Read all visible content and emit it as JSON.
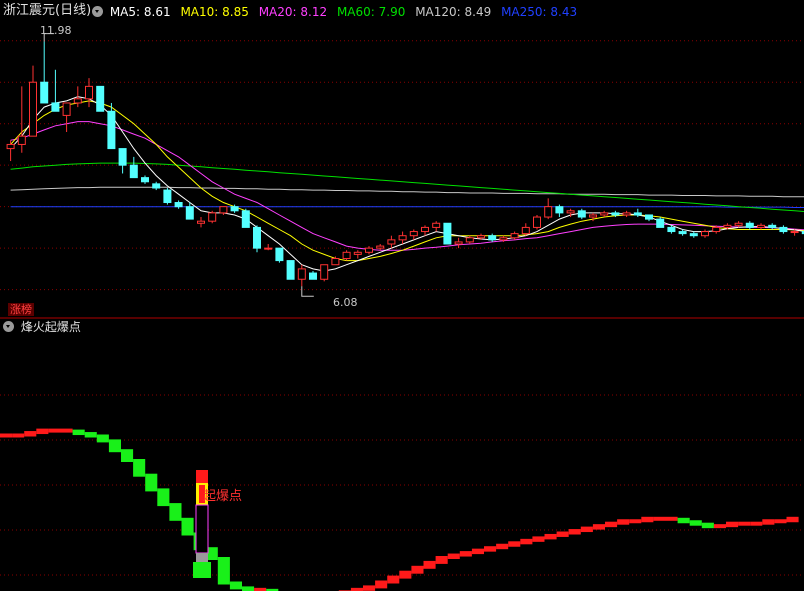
{
  "header": {
    "stock_title": "浙江震元(日线)",
    "ma_items": [
      {
        "label": "MA5: 8.61",
        "color": "#ffffff"
      },
      {
        "label": "MA10: 8.85",
        "color": "#ffff00"
      },
      {
        "label": "MA20: 8.12",
        "color": "#ff40ff"
      },
      {
        "label": "MA60: 7.90",
        "color": "#00e000"
      },
      {
        "label": "MA120: 8.49",
        "color": "#c8c8c8"
      },
      {
        "label": "MA250: 8.43",
        "color": "#2040ff"
      }
    ]
  },
  "main_panel": {
    "tag": "涨榜",
    "max_label": "11.98",
    "min_label": "6.08"
  },
  "indicator": {
    "title": "烽火起爆点",
    "signal_label": "起爆点"
  },
  "colors": {
    "up": "#ff3232",
    "down": "#54ffff",
    "grid": "#8a0000",
    "ma5": "#ffffff",
    "ma10": "#ffff00",
    "ma20": "#ff40ff",
    "ma60": "#00e000",
    "ma120": "#c8c8c8",
    "ma250": "#2040ff",
    "ind_up": "#ff1a1a",
    "ind_down": "#19f019"
  },
  "chart_data": [
    {
      "type": "candlestick",
      "ylim": [
        5.75,
        12.5
      ],
      "ohlc": [
        [
          9.4,
          9.6,
          9.1,
          9.5
        ],
        [
          9.5,
          10.9,
          9.3,
          9.7
        ],
        [
          9.7,
          11.4,
          9.7,
          11.0
        ],
        [
          11.0,
          11.98,
          10.8,
          10.5
        ],
        [
          10.5,
          11.3,
          10.3,
          10.3
        ],
        [
          10.2,
          10.5,
          9.8,
          10.5
        ],
        [
          10.5,
          10.9,
          10.4,
          10.6
        ],
        [
          10.6,
          11.1,
          10.4,
          10.9
        ],
        [
          10.9,
          10.9,
          10.3,
          10.3
        ],
        [
          10.3,
          10.5,
          9.4,
          9.4
        ],
        [
          9.4,
          9.4,
          8.8,
          9.0
        ],
        [
          9.0,
          9.2,
          8.7,
          8.7
        ],
        [
          8.7,
          8.75,
          8.55,
          8.6
        ],
        [
          8.55,
          8.6,
          8.4,
          8.45
        ],
        [
          8.4,
          8.45,
          8.05,
          8.1
        ],
        [
          8.1,
          8.15,
          7.95,
          8.0
        ],
        [
          8.0,
          8.1,
          7.7,
          7.7
        ],
        [
          7.6,
          7.75,
          7.5,
          7.65
        ],
        [
          7.65,
          7.9,
          7.6,
          7.85
        ],
        [
          7.85,
          8.0,
          7.8,
          8.0
        ],
        [
          8.0,
          8.05,
          7.85,
          7.9
        ],
        [
          7.9,
          7.95,
          7.5,
          7.5
        ],
        [
          7.5,
          7.55,
          6.9,
          7.0
        ],
        [
          7.0,
          7.1,
          6.95,
          7.0
        ],
        [
          7.0,
          7.0,
          6.65,
          6.7
        ],
        [
          6.7,
          6.7,
          6.3,
          6.25
        ],
        [
          6.25,
          6.6,
          6.08,
          6.5
        ],
        [
          6.4,
          6.45,
          6.25,
          6.25
        ],
        [
          6.25,
          6.6,
          6.2,
          6.6
        ],
        [
          6.6,
          6.8,
          6.6,
          6.75
        ],
        [
          6.75,
          6.95,
          6.7,
          6.9
        ],
        [
          6.85,
          6.95,
          6.75,
          6.9
        ],
        [
          6.9,
          7.05,
          6.85,
          7.0
        ],
        [
          7.0,
          7.1,
          6.95,
          7.05
        ],
        [
          7.1,
          7.3,
          7.0,
          7.2
        ],
        [
          7.2,
          7.4,
          7.1,
          7.3
        ],
        [
          7.3,
          7.45,
          7.2,
          7.4
        ],
        [
          7.4,
          7.55,
          7.3,
          7.5
        ],
        [
          7.5,
          7.65,
          7.4,
          7.6
        ],
        [
          7.6,
          7.6,
          7.1,
          7.1
        ],
        [
          7.1,
          7.25,
          7.0,
          7.15
        ],
        [
          7.15,
          7.3,
          7.1,
          7.25
        ],
        [
          7.25,
          7.35,
          7.2,
          7.3
        ],
        [
          7.3,
          7.35,
          7.15,
          7.2
        ],
        [
          7.2,
          7.3,
          7.15,
          7.25
        ],
        [
          7.25,
          7.4,
          7.2,
          7.35
        ],
        [
          7.35,
          7.6,
          7.3,
          7.5
        ],
        [
          7.5,
          7.8,
          7.45,
          7.75
        ],
        [
          7.75,
          8.2,
          7.7,
          8.0
        ],
        [
          8.0,
          8.05,
          7.75,
          7.85
        ],
        [
          7.85,
          7.95,
          7.75,
          7.9
        ],
        [
          7.9,
          7.95,
          7.7,
          7.75
        ],
        [
          7.75,
          7.85,
          7.65,
          7.8
        ],
        [
          7.8,
          7.9,
          7.75,
          7.85
        ],
        [
          7.85,
          7.9,
          7.75,
          7.8
        ],
        [
          7.8,
          7.9,
          7.75,
          7.85
        ],
        [
          7.85,
          7.95,
          7.75,
          7.8
        ],
        [
          7.8,
          7.8,
          7.65,
          7.7
        ],
        [
          7.7,
          7.75,
          7.5,
          7.5
        ],
        [
          7.5,
          7.55,
          7.35,
          7.4
        ],
        [
          7.4,
          7.45,
          7.3,
          7.35
        ],
        [
          7.35,
          7.4,
          7.25,
          7.3
        ],
        [
          7.3,
          7.45,
          7.25,
          7.4
        ],
        [
          7.4,
          7.55,
          7.35,
          7.5
        ],
        [
          7.5,
          7.6,
          7.45,
          7.55
        ],
        [
          7.55,
          7.65,
          7.5,
          7.6
        ],
        [
          7.6,
          7.65,
          7.45,
          7.5
        ],
        [
          7.5,
          7.6,
          7.45,
          7.55
        ],
        [
          7.55,
          7.6,
          7.45,
          7.5
        ],
        [
          7.5,
          7.55,
          7.35,
          7.4
        ],
        [
          7.4,
          7.45,
          7.3,
          7.4
        ],
        [
          7.4,
          7.45,
          7.3,
          7.35
        ],
        [
          7.35,
          7.35,
          6.85,
          6.95
        ]
      ],
      "ma5": [
        9.4,
        9.7,
        10.1,
        10.4,
        10.5,
        10.55,
        10.65,
        10.6,
        10.45,
        10.2,
        9.8,
        9.4,
        9.05,
        8.75,
        8.5,
        8.3,
        8.1,
        7.9,
        7.85,
        7.85,
        7.8,
        7.7,
        7.5,
        7.3,
        7.1,
        6.85,
        6.6,
        6.5,
        6.45,
        6.5,
        6.6,
        6.7,
        6.8,
        6.9,
        7.0,
        7.1,
        7.2,
        7.3,
        7.4,
        7.35,
        7.3,
        7.25,
        7.22,
        7.2,
        7.22,
        7.25,
        7.3,
        7.4,
        7.55,
        7.7,
        7.8,
        7.85,
        7.85,
        7.85,
        7.83,
        7.83,
        7.8,
        7.75,
        7.65,
        7.55,
        7.45,
        7.4,
        7.4,
        7.42,
        7.47,
        7.5,
        7.52,
        7.52,
        7.5,
        7.47,
        7.44,
        7.4,
        7.3
      ],
      "ma10": [
        9.5,
        9.8,
        10.0,
        10.2,
        10.35,
        10.45,
        10.5,
        10.55,
        10.5,
        10.4,
        10.2,
        10.0,
        9.75,
        9.5,
        9.2,
        8.95,
        8.7,
        8.45,
        8.25,
        8.1,
        8.0,
        7.9,
        7.75,
        7.6,
        7.45,
        7.3,
        7.1,
        6.95,
        6.85,
        6.75,
        6.7,
        6.7,
        6.75,
        6.8,
        6.87,
        6.95,
        7.05,
        7.15,
        7.25,
        7.3,
        7.3,
        7.3,
        7.3,
        7.3,
        7.3,
        7.3,
        7.32,
        7.35,
        7.4,
        7.5,
        7.58,
        7.65,
        7.7,
        7.75,
        7.78,
        7.8,
        7.8,
        7.78,
        7.75,
        7.7,
        7.65,
        7.6,
        7.55,
        7.5,
        7.47,
        7.45,
        7.45,
        7.45,
        7.45,
        7.45,
        7.44,
        7.42,
        7.38
      ],
      "ma20": [
        9.6,
        9.65,
        9.75,
        9.85,
        9.95,
        10.0,
        10.05,
        10.05,
        10.0,
        9.95,
        9.85,
        9.75,
        9.65,
        9.5,
        9.35,
        9.2,
        9.0,
        8.8,
        8.6,
        8.45,
        8.3,
        8.2,
        8.1,
        7.95,
        7.8,
        7.65,
        7.5,
        7.35,
        7.25,
        7.15,
        7.05,
        7.0,
        6.97,
        6.95,
        6.95,
        6.95,
        6.97,
        7.0,
        7.02,
        7.05,
        7.08,
        7.1,
        7.12,
        7.15,
        7.18,
        7.2,
        7.23,
        7.25,
        7.3,
        7.35,
        7.4,
        7.45,
        7.5,
        7.53,
        7.55,
        7.57,
        7.58,
        7.58,
        7.58,
        7.57,
        7.56,
        7.55,
        7.54,
        7.53,
        7.52,
        7.51,
        7.5,
        7.5,
        7.49,
        7.48,
        7.46,
        7.44,
        7.4
      ],
      "ma60": [
        8.9,
        8.93,
        8.96,
        8.98,
        9.0,
        9.02,
        9.03,
        9.04,
        9.05,
        9.05,
        9.05,
        9.05,
        9.04,
        9.03,
        9.02,
        9.0,
        8.98,
        8.96,
        8.94,
        8.92,
        8.9,
        8.88,
        8.86,
        8.84,
        8.82,
        8.8,
        8.78,
        8.76,
        8.74,
        8.72,
        8.7,
        8.68,
        8.66,
        8.64,
        8.62,
        8.6,
        8.58,
        8.56,
        8.54,
        8.52,
        8.5,
        8.48,
        8.46,
        8.44,
        8.42,
        8.4,
        8.38,
        8.36,
        8.34,
        8.32,
        8.3,
        8.28,
        8.26,
        8.24,
        8.22,
        8.2,
        8.18,
        8.16,
        8.14,
        8.12,
        8.1,
        8.08,
        8.06,
        8.04,
        8.02,
        8.0,
        7.98,
        7.96,
        7.94,
        7.92,
        7.9,
        7.88,
        7.86
      ],
      "ma120": [
        8.4,
        8.41,
        8.42,
        8.43,
        8.44,
        8.45,
        8.46,
        8.46,
        8.47,
        8.47,
        8.47,
        8.47,
        8.47,
        8.47,
        8.47,
        8.46,
        8.46,
        8.45,
        8.45,
        8.44,
        8.44,
        8.43,
        8.43,
        8.42,
        8.42,
        8.41,
        8.41,
        8.4,
        8.4,
        8.39,
        8.39,
        8.38,
        8.38,
        8.37,
        8.37,
        8.36,
        8.36,
        8.35,
        8.35,
        8.34,
        8.34,
        8.33,
        8.33,
        8.33,
        8.32,
        8.32,
        8.32,
        8.31,
        8.31,
        8.31,
        8.3,
        8.3,
        8.3,
        8.3,
        8.29,
        8.29,
        8.29,
        8.28,
        8.28,
        8.28,
        8.27,
        8.27,
        8.27,
        8.26,
        8.26,
        8.26,
        8.25,
        8.25,
        8.25,
        8.24,
        8.24,
        8.24,
        8.23
      ],
      "ma250": [
        8.0,
        8.0,
        8.0,
        8.0,
        8.0,
        8.0,
        8.0,
        8.0,
        8.0,
        8.0,
        8.0,
        8.0,
        8.0,
        8.0,
        8.0,
        8.0,
        8.0,
        8.0,
        8.0,
        8.0,
        8.0,
        8.0,
        8.0,
        8.0,
        8.0,
        8.0,
        8.0,
        8.0,
        8.0,
        8.0,
        8.0,
        8.0,
        8.0,
        8.0,
        8.0,
        8.0,
        8.0,
        8.0,
        8.0,
        8.0,
        8.0,
        8.0,
        8.0,
        8.0,
        8.0,
        8.0,
        8.0,
        8.0,
        8.0,
        8.0,
        8.0,
        8.0,
        8.0,
        8.0,
        8.0,
        8.0,
        8.0,
        8.0,
        8.0,
        8.0,
        8.0,
        8.0,
        8.0,
        8.0,
        7.99,
        7.99,
        7.99,
        7.99,
        7.99,
        7.99,
        7.98,
        7.98,
        7.98
      ],
      "gridlines": [
        12.0,
        11.0,
        10.0,
        9.0,
        8.0,
        7.0,
        6.0
      ],
      "max": {
        "index": 3,
        "value": 11.98
      },
      "min": {
        "index": 26,
        "value": 6.08
      }
    },
    {
      "type": "line",
      "ylim": [
        0,
        100
      ],
      "values": [
        70,
        70,
        71,
        72,
        72,
        72,
        71,
        70,
        68,
        64,
        60,
        54,
        48,
        42,
        36,
        30,
        24,
        20,
        10,
        8,
        6,
        7,
        6,
        5,
        5,
        5,
        5,
        5,
        6,
        7,
        8,
        10,
        12,
        14,
        16,
        18,
        20,
        21,
        22,
        23,
        24,
        25,
        26,
        27,
        28,
        29,
        30,
        31,
        32,
        33,
        34,
        35,
        35,
        36,
        36,
        36,
        35,
        34,
        33,
        33,
        34,
        34,
        34,
        35,
        35,
        36
      ]
    }
  ]
}
